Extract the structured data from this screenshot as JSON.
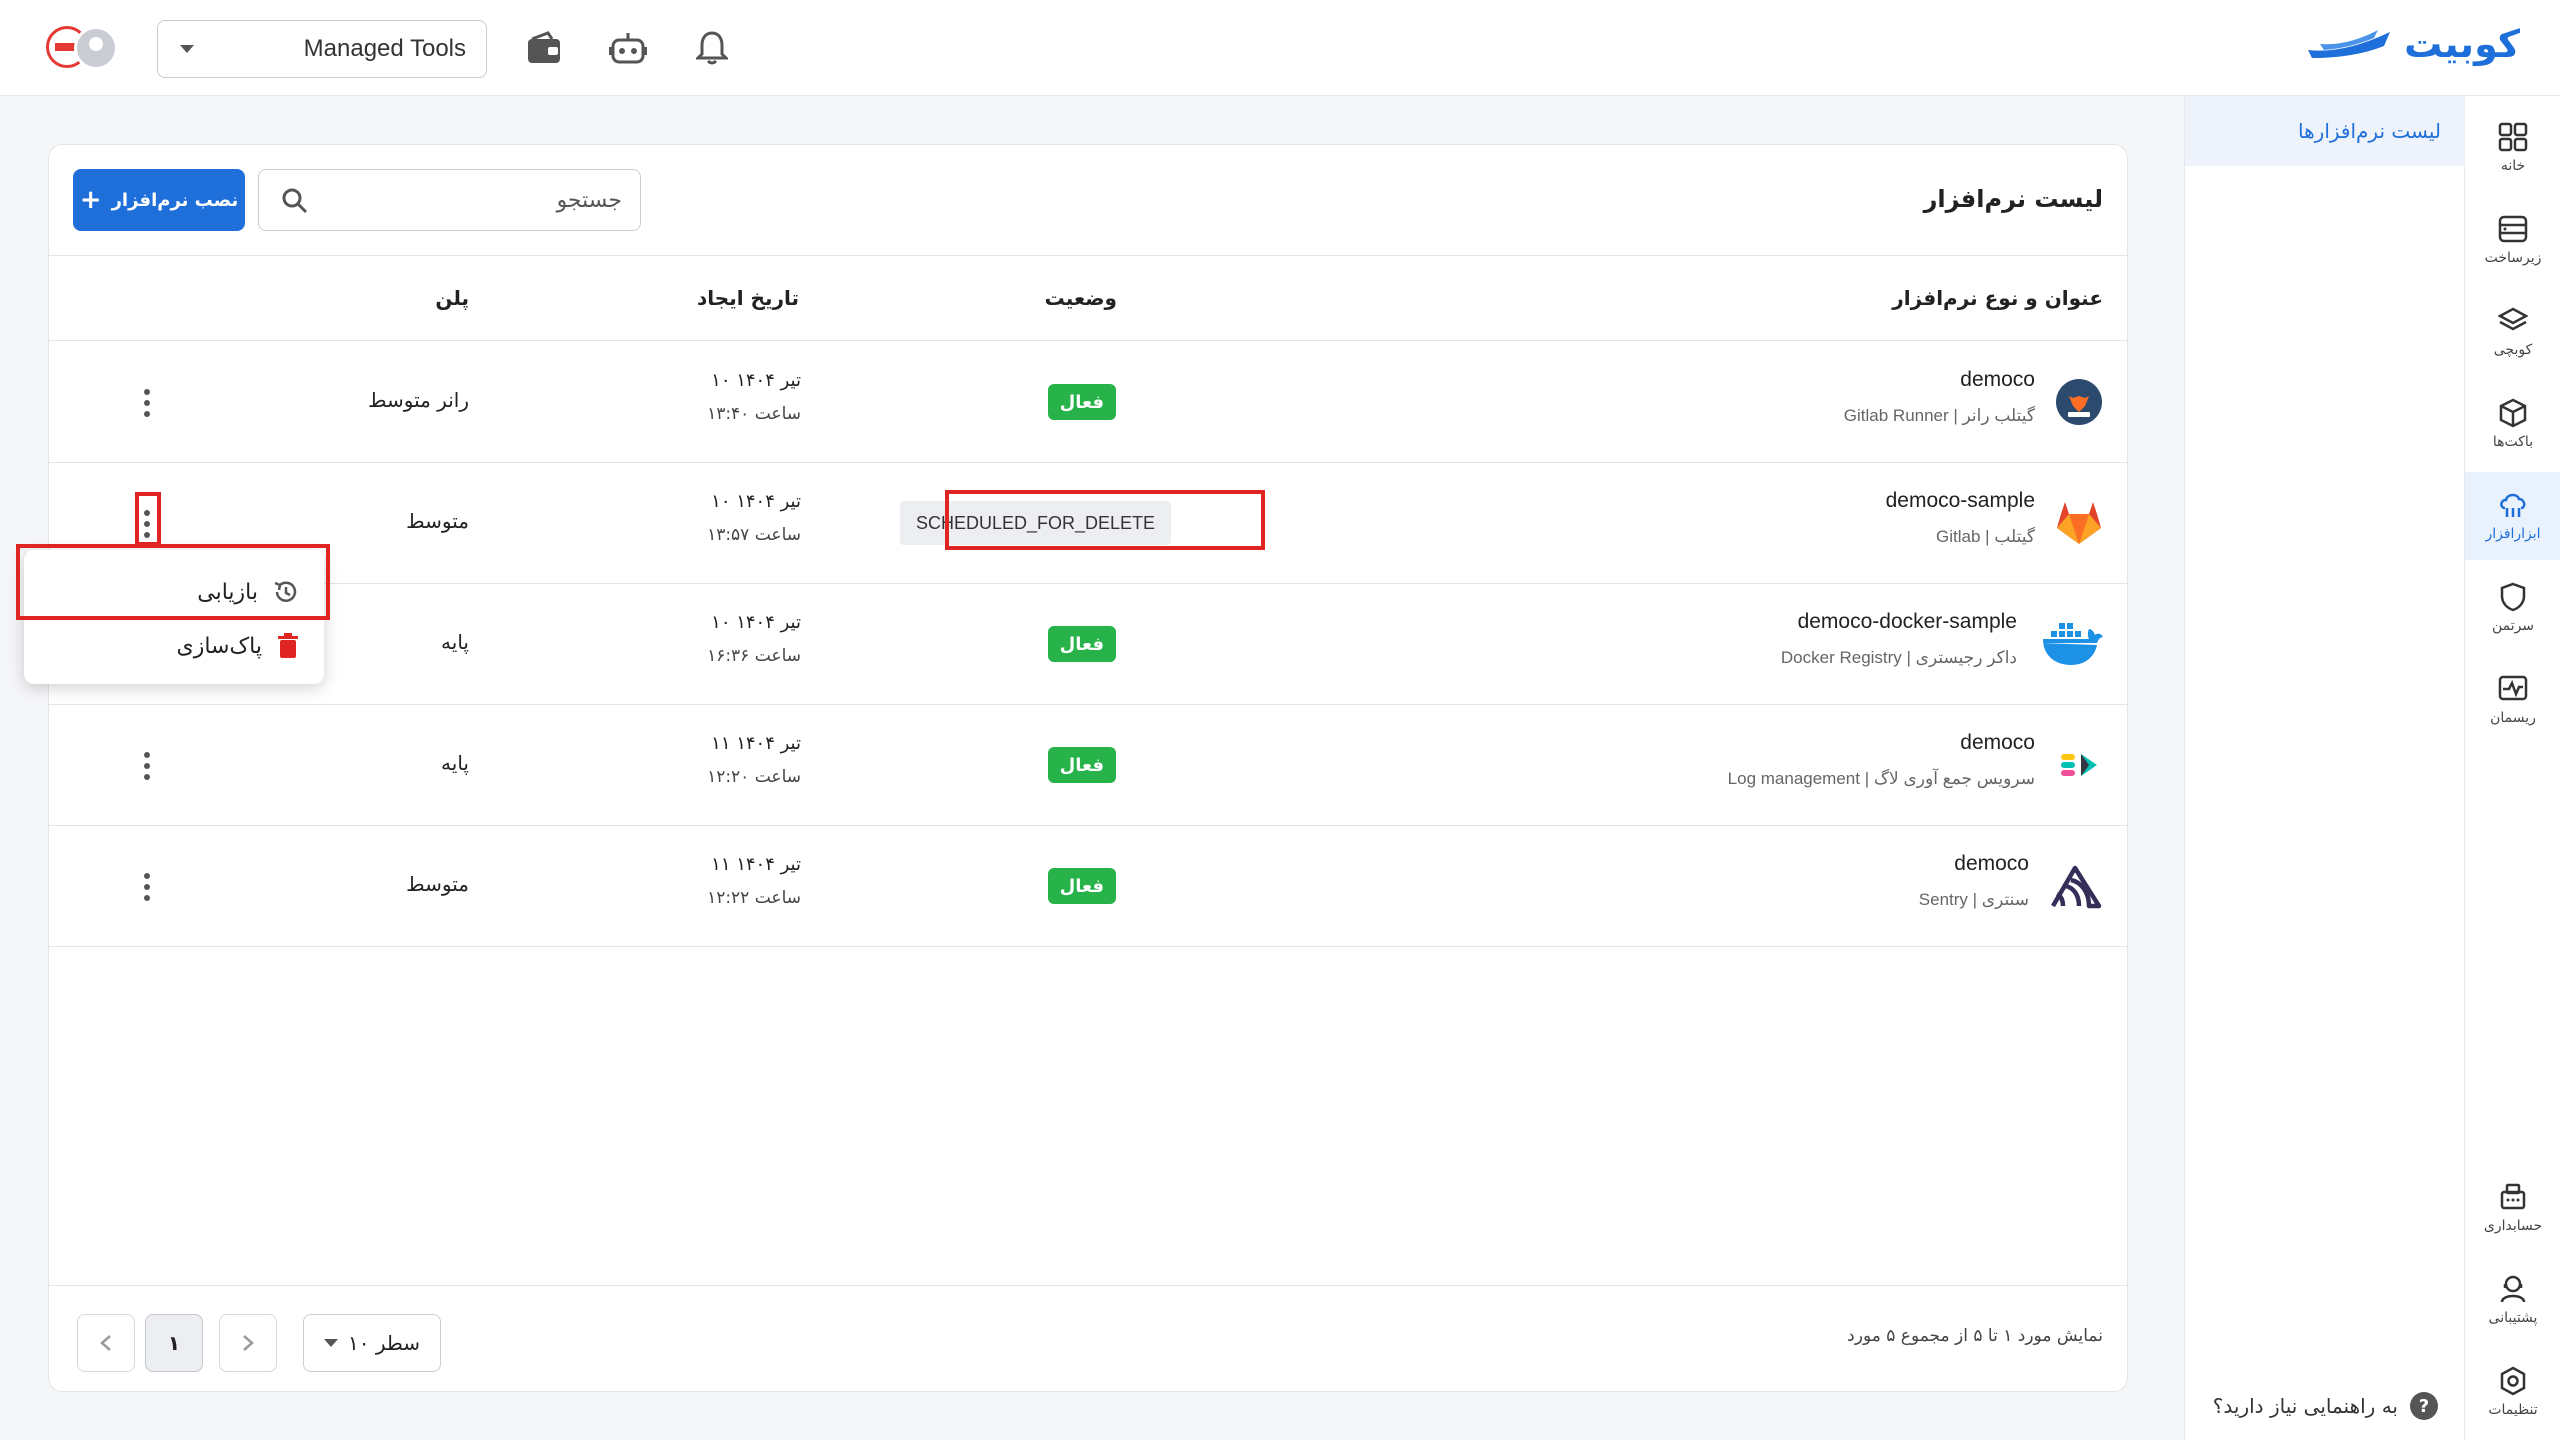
{
  "header": {
    "brand": "کوبیت",
    "project": "Managed Tools",
    "icons": [
      "wallet-icon",
      "robot-icon",
      "bell-icon"
    ]
  },
  "sidebar": {
    "items": [
      {
        "label": "خانه",
        "icon": "grid-icon"
      },
      {
        "label": "زیرساخت",
        "icon": "server-icon"
      },
      {
        "label": "کوبچی",
        "icon": "layers-icon"
      },
      {
        "label": "باکت‌ها",
        "icon": "box-icon"
      },
      {
        "label": "ابزارافزار",
        "icon": "cloud-tools-icon",
        "active": true
      },
      {
        "label": "سرتمن",
        "icon": "shield-icon"
      },
      {
        "label": "ریسمان",
        "icon": "monitor-icon"
      },
      {
        "label": "حسابداری",
        "icon": "accounting-icon"
      },
      {
        "label": "پشتیبانی",
        "icon": "support-icon"
      },
      {
        "label": "تنظیمات",
        "icon": "settings-icon"
      }
    ]
  },
  "subnav": {
    "item": "لیست نرم‌افزارها",
    "help": "به راهنمایی نیاز دارید؟",
    "help_icon": "?"
  },
  "card": {
    "title": "لیست نرم‌افزار",
    "install_label": "نصب نرم‌افزار",
    "search_placeholder": "جستجو"
  },
  "table": {
    "headers": {
      "name": "عنوان و نوع نرم‌افزار",
      "status": "وضعیت",
      "created": "تاریخ ایجاد",
      "plan": "پلن"
    },
    "rows": [
      {
        "name": "democo",
        "type": "Gitlab Runner | گیتلب رانر",
        "logo": "gitlab-runner-logo",
        "status": "فعال",
        "date": "۱۰ تیر ۱۴۰۴",
        "time": "ساعت ۱۳:۴۰",
        "plan": "رانر متوسط"
      },
      {
        "name": "democo-sample",
        "type": "Gitlab | گیتلب",
        "logo": "gitlab-logo",
        "status": "SCHEDULED_FOR_DELETE",
        "date": "۱۰ تیر ۱۴۰۴",
        "time": "ساعت ۱۳:۵۷",
        "plan": "متوسط"
      },
      {
        "name": "democo-docker-sample",
        "type": "Docker Registry | داکر رجیستری",
        "logo": "docker-logo",
        "status": "فعال",
        "date": "۱۰ تیر ۱۴۰۴",
        "time": "ساعت ۱۶:۳۶",
        "plan": "پایه"
      },
      {
        "name": "democo",
        "type": "Log management | سرویس جمع آوری لاگ",
        "logo": "elastic-logo",
        "status": "فعال",
        "date": "۱۱ تیر ۱۴۰۴",
        "time": "ساعت ۱۲:۲۰",
        "plan": "پایه"
      },
      {
        "name": "democo",
        "type": "Sentry | سنتری",
        "logo": "sentry-logo",
        "status": "فعال",
        "date": "۱۱ تیر ۱۴۰۴",
        "time": "ساعت ۱۲:۲۲",
        "plan": "متوسط"
      }
    ]
  },
  "row_menu": {
    "restore": "بازیابی",
    "purge": "پاک‌سازی"
  },
  "footer": {
    "info": "نمایش مورد ۱ تا ۵ از مجموع ۵ مورد",
    "rows_per_page": "۱۰ سطر",
    "current_page": "۱"
  },
  "colors": {
    "primary": "#1e6fd9",
    "active_badge": "#27b24a",
    "highlight": "#e02424"
  }
}
